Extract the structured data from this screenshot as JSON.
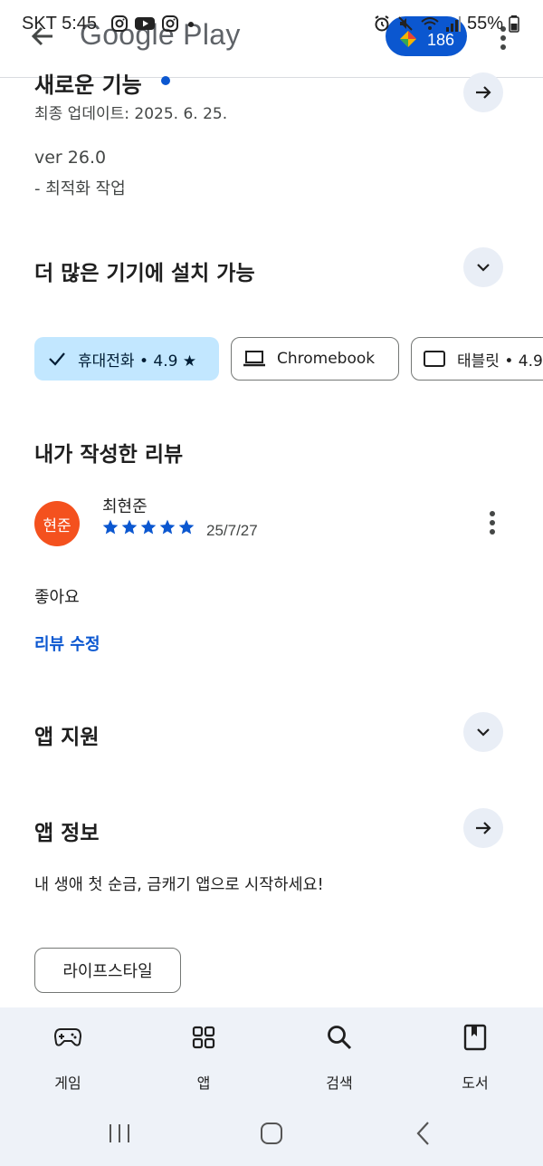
{
  "status_bar": {
    "carrier_time": "SKT 5:45",
    "battery": "55%"
  },
  "header": {
    "title": "Google Play",
    "points": "186"
  },
  "whats_new": {
    "title": "새로운 기능",
    "last_updated": "최종 업데이트: 2025. 6. 25.",
    "version": "ver 26.0",
    "notes": "- 최적화 작업"
  },
  "devices": {
    "title": "더 많은 기기에 설치 가능",
    "chips": [
      {
        "label": "휴대전화 • 4.9 ★",
        "selected": true,
        "icon": "check-icon"
      },
      {
        "label": "Chromebook",
        "selected": false,
        "icon": "laptop-icon"
      },
      {
        "label": "태블릿 • 4.9",
        "selected": false,
        "icon": "tablet-icon"
      }
    ]
  },
  "my_review": {
    "title": "내가 작성한 리뷰",
    "avatar_text": "현준",
    "reviewer": "최현준",
    "rating": 5,
    "date": "25/7/27",
    "body": "좋아요",
    "edit_label": "리뷰 수정"
  },
  "app_support": {
    "title": "앱 지원"
  },
  "app_info": {
    "title": "앱 정보",
    "description": "내 생애 첫 순금, 금캐기 앱으로 시작하세요!",
    "category": "라이프스타일"
  },
  "bottom_nav": {
    "items": [
      {
        "label": "게임",
        "icon": "gamepad-icon"
      },
      {
        "label": "앱",
        "icon": "apps-grid-icon"
      },
      {
        "label": "검색",
        "icon": "search-icon"
      },
      {
        "label": "도서",
        "icon": "book-icon"
      }
    ]
  },
  "colors": {
    "accent": "#0b57d0",
    "chip_selected": "#c2e7ff",
    "round_button": "#e9eef6",
    "avatar": "#f4511e",
    "nav_bg": "#eef2f8"
  }
}
